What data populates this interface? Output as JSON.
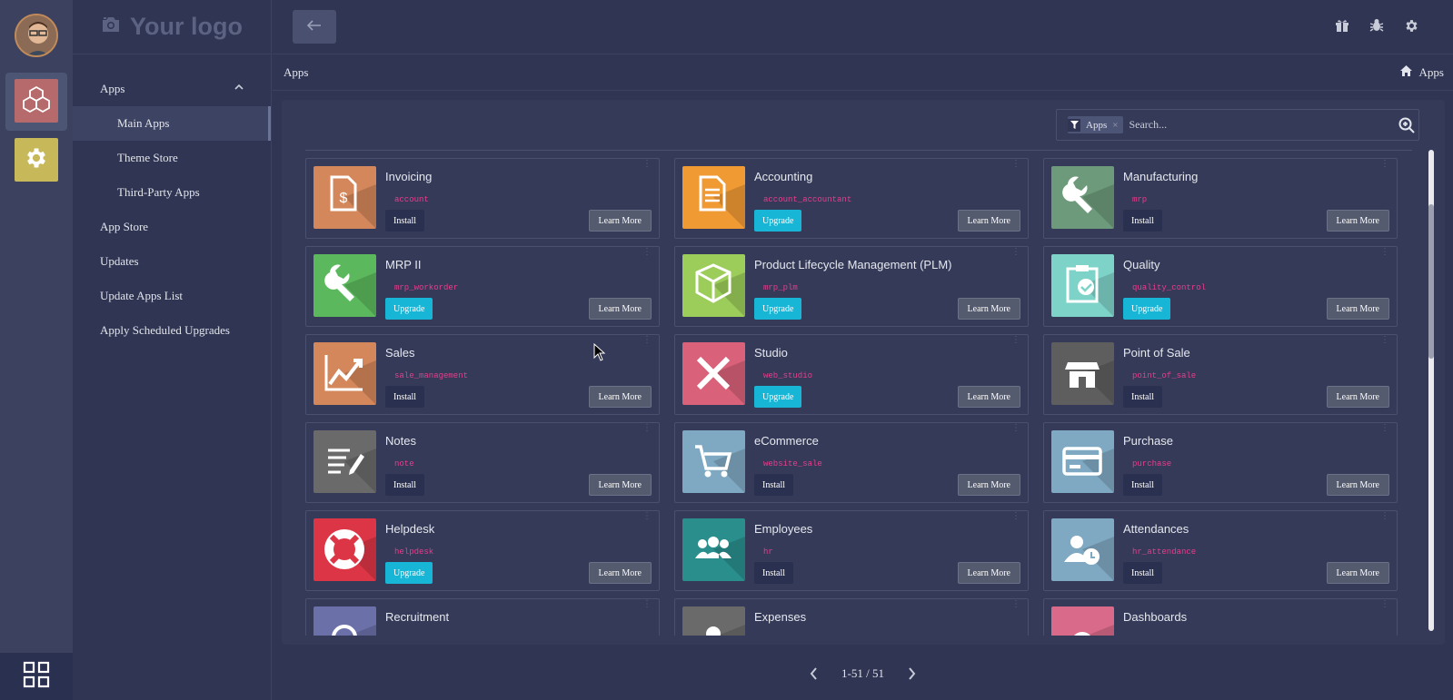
{
  "brand": {
    "logo_text": "Your logo"
  },
  "sidebar": {
    "items": [
      {
        "label": "Apps",
        "level": 1,
        "active": false,
        "expanded": true
      },
      {
        "label": "Main Apps",
        "level": 2,
        "active": true
      },
      {
        "label": "Theme Store",
        "level": 2,
        "active": false
      },
      {
        "label": "Third-Party Apps",
        "level": 2,
        "active": false
      },
      {
        "label": "App Store",
        "level": 1,
        "active": false
      },
      {
        "label": "Updates",
        "level": 1,
        "active": false
      },
      {
        "label": "Update Apps List",
        "level": 1,
        "active": false
      },
      {
        "label": "Apply Scheduled Upgrades",
        "level": 1,
        "active": false
      }
    ]
  },
  "breadcrumb": {
    "current": "Apps",
    "home_label": "Apps"
  },
  "search": {
    "facet_label": "Apps",
    "placeholder": "Search..."
  },
  "apps": [
    {
      "name": "Invoicing",
      "tech": "account",
      "action": "Install",
      "icon": "invoice-icon",
      "color": "#d3875a"
    },
    {
      "name": "Accounting",
      "tech": "account_accountant",
      "action": "Upgrade",
      "icon": "document-icon",
      "color": "#f09a34"
    },
    {
      "name": "Manufacturing",
      "tech": "mrp",
      "action": "Install",
      "icon": "wrench-icon",
      "color": "#6d9a7a"
    },
    {
      "name": "MRP II",
      "tech": "mrp_workorder",
      "action": "Upgrade",
      "icon": "wrench-icon",
      "color": "#5cb85c"
    },
    {
      "name": "Product Lifecycle Management (PLM)",
      "tech": "mrp_plm",
      "action": "Upgrade",
      "icon": "box-icon",
      "color": "#9ccc5a"
    },
    {
      "name": "Quality",
      "tech": "quality_control",
      "action": "Upgrade",
      "icon": "clipboard-check-icon",
      "color": "#7ed3c9"
    },
    {
      "name": "Sales",
      "tech": "sale_management",
      "action": "Install",
      "icon": "trend-chart-icon",
      "color": "#d3875a"
    },
    {
      "name": "Studio",
      "tech": "web_studio",
      "action": "Upgrade",
      "icon": "tools-icon",
      "color": "#d9627a"
    },
    {
      "name": "Point of Sale",
      "tech": "point_of_sale",
      "action": "Install",
      "icon": "store-icon",
      "color": "#5e5e5e"
    },
    {
      "name": "Notes",
      "tech": "note",
      "action": "Install",
      "icon": "note-pencil-icon",
      "color": "#6a6a6a"
    },
    {
      "name": "eCommerce",
      "tech": "website_sale",
      "action": "Install",
      "icon": "cart-icon",
      "color": "#7fa9c2"
    },
    {
      "name": "Purchase",
      "tech": "purchase",
      "action": "Install",
      "icon": "credit-card-icon",
      "color": "#7fa9c2"
    },
    {
      "name": "Helpdesk",
      "tech": "helpdesk",
      "action": "Upgrade",
      "icon": "lifebuoy-icon",
      "color": "#dc3545"
    },
    {
      "name": "Employees",
      "tech": "hr",
      "action": "Install",
      "icon": "users-icon",
      "color": "#2a8f8c"
    },
    {
      "name": "Attendances",
      "tech": "hr_attendance",
      "action": "Install",
      "icon": "user-clock-icon",
      "color": "#7fa9c2"
    },
    {
      "name": "Recruitment",
      "tech": "",
      "action": "",
      "icon": "search-user-icon",
      "color": "#6b70a8"
    },
    {
      "name": "Expenses",
      "tech": "",
      "action": "",
      "icon": "user-icon",
      "color": "#6a6a6a"
    },
    {
      "name": "Dashboards",
      "tech": "",
      "action": "",
      "icon": "gauge-icon",
      "color": "#d96a8a"
    }
  ],
  "learn_more_label": "Learn More",
  "pager": {
    "value": "1-51 / 51"
  }
}
